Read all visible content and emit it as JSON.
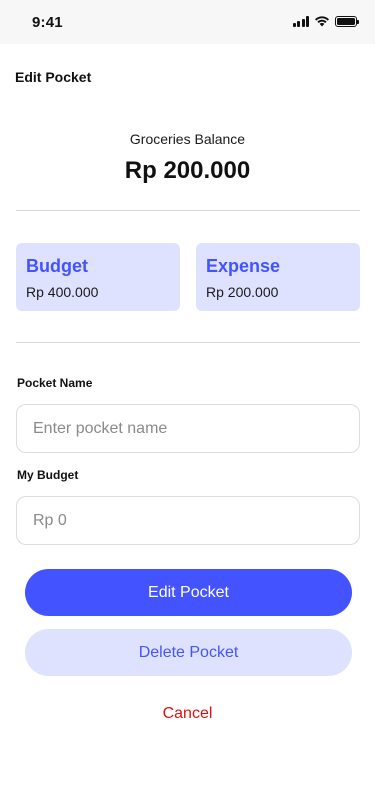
{
  "status_bar": {
    "time": "9:41",
    "icons": [
      "signal-icon",
      "wifi-icon",
      "battery-icon"
    ]
  },
  "header": {
    "title": "Edit Pocket"
  },
  "balance": {
    "label": "Groceries Balance",
    "value": "Rp 200.000"
  },
  "cards": {
    "budget": {
      "title": "Budget",
      "value": "Rp 400.000"
    },
    "expense": {
      "title": "Expense",
      "value": "Rp 200.000"
    }
  },
  "form": {
    "pocket_name": {
      "label": "Pocket Name",
      "value": "",
      "placeholder": "Enter pocket name"
    },
    "budget": {
      "label": "My Budget",
      "value": "",
      "placeholder": "Rp 0"
    }
  },
  "actions": {
    "edit_label": "Edit Pocket",
    "delete_label": "Delete Pocket",
    "cancel_label": "Cancel"
  },
  "colors": {
    "accent": "#4353FF",
    "accent_light": "#DFE2FF",
    "danger": "#DD1111",
    "status_bar_bg": "#F7F7F7"
  }
}
